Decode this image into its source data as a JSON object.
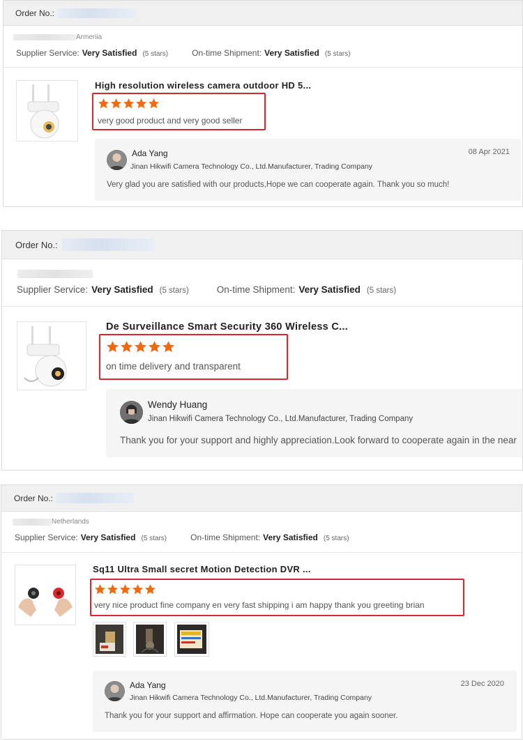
{
  "reviews": [
    {
      "order_label": "Order No.:",
      "country": "Armenia",
      "supplier_label": "Supplier Service:",
      "supplier_value": "Very Satisfied",
      "supplier_stars": "(5 stars)",
      "shipment_label": "On-time Shipment:",
      "shipment_value": "Very Satisfied",
      "shipment_stars": "(5 stars)",
      "product_title": "High resolution wireless camera outdoor HD 5...",
      "rating": 5,
      "review_text": "very good product and very good seller",
      "reply": {
        "name": "Ada Yang",
        "company": "Jinan Hikwifi Camera Technology Co., Ltd.Manufacturer, Trading Company",
        "date": "08 Apr 2021",
        "text": "Very glad you are satisfied with our products,Hope we can cooperate again. Thank you so much!"
      }
    },
    {
      "order_label": "Order No.:",
      "country": "",
      "supplier_label": "Supplier Service:",
      "supplier_value": "Very Satisfied",
      "supplier_stars": "(5 stars)",
      "shipment_label": "On-time Shipment:",
      "shipment_value": "Very Satisfied",
      "shipment_stars": "(5 stars)",
      "product_title": "De Surveillance Smart Security 360 Wireless C...",
      "rating": 5,
      "review_text": "on time delivery and transparent",
      "reply": {
        "name": "Wendy Huang",
        "company": "Jinan Hikwifi Camera Technology Co., Ltd.Manufacturer, Trading Company",
        "date": "",
        "text": "Thank you for your support and highly appreciation.Look forward to cooperate again in the near"
      }
    },
    {
      "order_label": "Order No.:",
      "country": "Netherlands",
      "supplier_label": "Supplier Service:",
      "supplier_value": "Very Satisfied",
      "supplier_stars": "(5 stars)",
      "shipment_label": "On-time Shipment:",
      "shipment_value": "Very Satisfied",
      "shipment_stars": "(5 stars)",
      "product_title": "Sq11 Ultra Small secret Motion Detection DVR ...",
      "rating": 5,
      "review_text": "very nice product fine company en very fast shipping i am happy thank you greeting brian",
      "reply": {
        "name": "Ada Yang",
        "company": "Jinan Hikwifi Camera Technology Co., Ltd.Manufacturer, Trading Company",
        "date": "23 Dec 2020",
        "text": "Thank you for your support and affirmation. Hope can cooperate you again sooner."
      }
    }
  ],
  "colors": {
    "star": "#f26a10",
    "highlight_border": "#d6262e",
    "header_bg": "#f0f0f0",
    "reply_bg": "#f5f5f5"
  },
  "icons": {
    "star": "star-icon",
    "avatar": "avatar"
  }
}
